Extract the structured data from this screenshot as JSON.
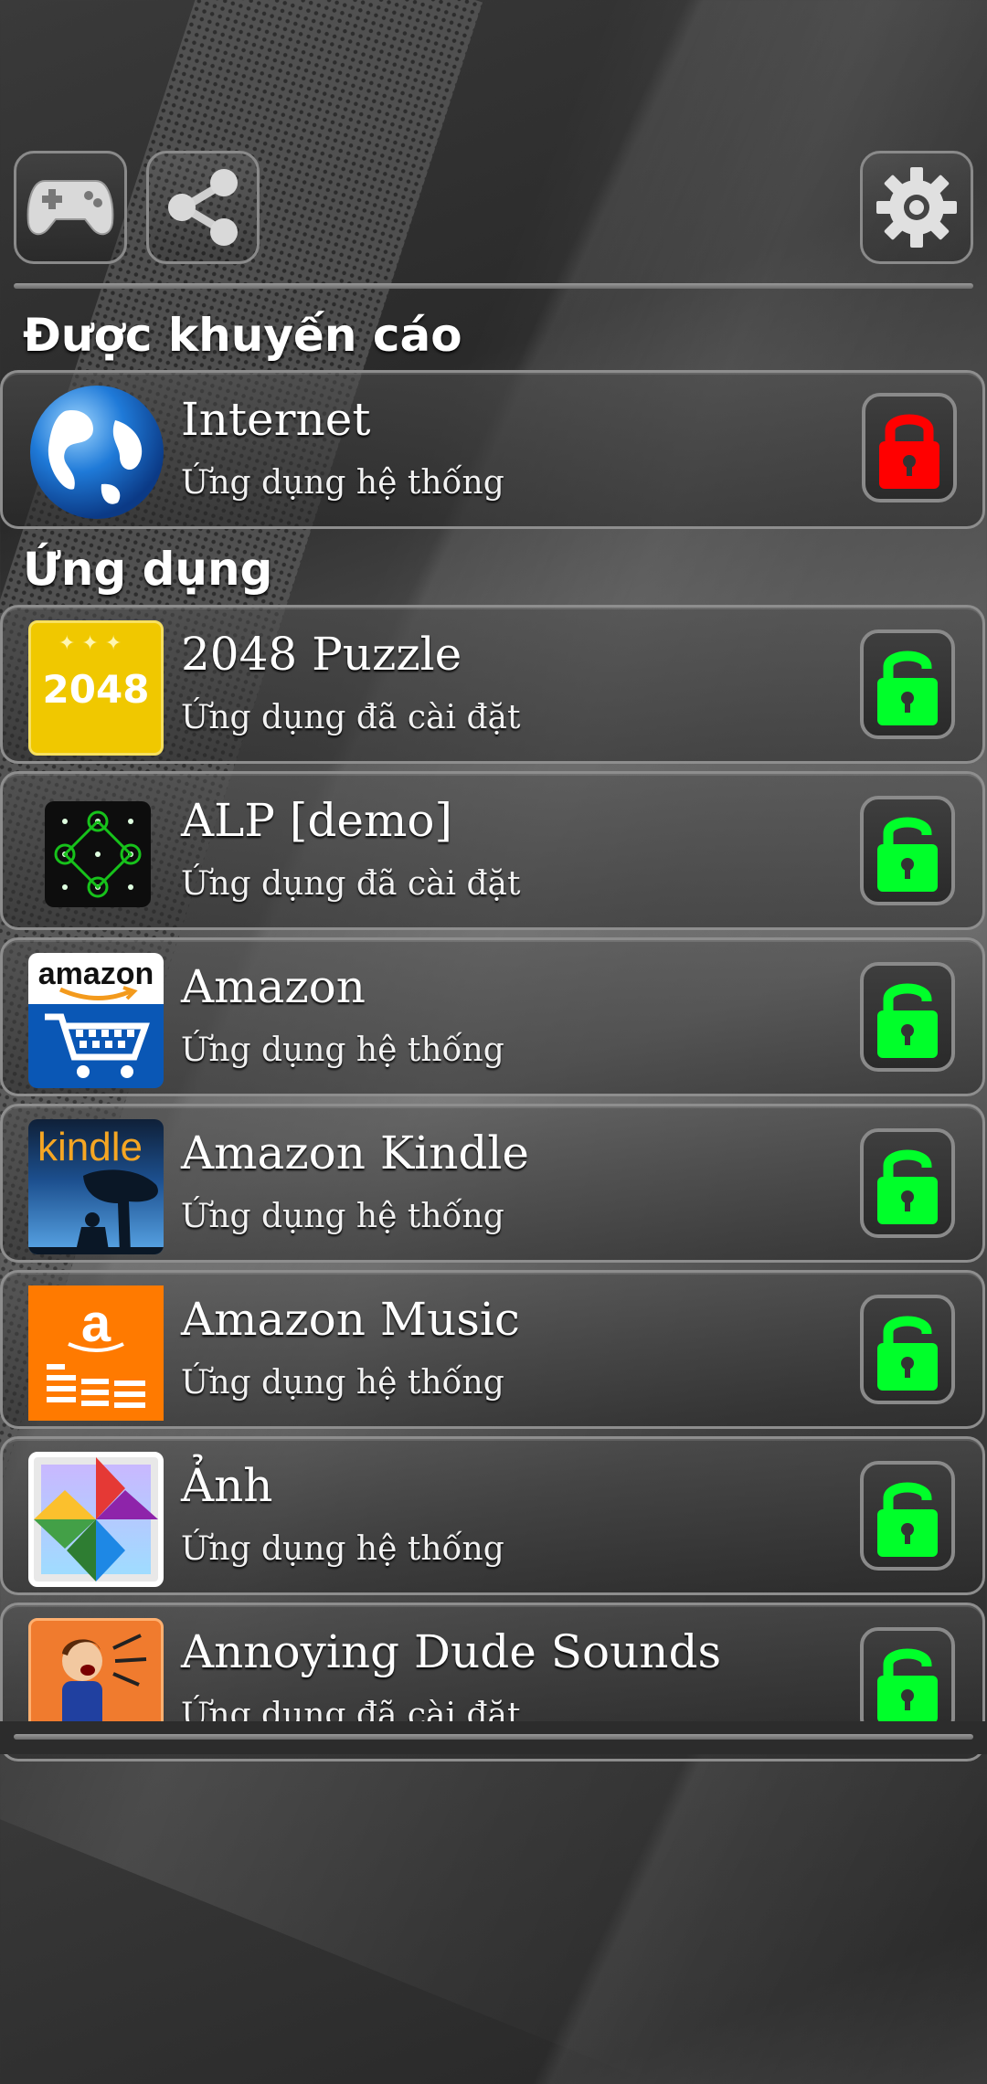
{
  "toolbar": {
    "left_icons": [
      "gamepad-icon",
      "share-icon"
    ],
    "right_icon": "gear-icon"
  },
  "sections": {
    "recommended_title": "Được khuyến cáo",
    "apps_title": "Ứng dụng"
  },
  "recommended": [
    {
      "title": "Internet",
      "subtitle": "Ứng dụng hệ thống",
      "icon": "globe-icon",
      "lock": "locked",
      "lock_color": "#ff0000"
    }
  ],
  "apps": [
    {
      "title": "2048 Puzzle",
      "subtitle": "Ứng dụng đã cài đặt",
      "icon": "2048-icon",
      "icon_text": "2048",
      "lock": "unlocked"
    },
    {
      "title": "ALP [demo]",
      "subtitle": "Ứng dụng đã cài đặt",
      "icon": "pattern-lock-icon",
      "lock": "unlocked"
    },
    {
      "title": "Amazon",
      "subtitle": "Ứng dụng hệ thống",
      "icon": "amazon-cart-icon",
      "icon_text": "amazon",
      "lock": "unlocked"
    },
    {
      "title": "Amazon Kindle",
      "subtitle": "Ứng dụng hệ thống",
      "icon": "kindle-icon",
      "icon_text": "kindle",
      "lock": "unlocked"
    },
    {
      "title": "Amazon Music",
      "subtitle": "Ứng dụng hệ thống",
      "icon": "amazon-music-icon",
      "icon_text": "a",
      "lock": "unlocked"
    },
    {
      "title": "Ảnh",
      "subtitle": "Ứng dụng hệ thống",
      "icon": "photos-pinwheel-icon",
      "lock": "unlocked"
    },
    {
      "title": "Annoying Dude Sounds",
      "subtitle": "Ứng dụng đã cài đặt",
      "icon": "annoying-dude-icon",
      "lock": "unlocked"
    }
  ],
  "colors": {
    "unlocked_green": "#00ff2a",
    "locked_red": "#ff0000"
  }
}
